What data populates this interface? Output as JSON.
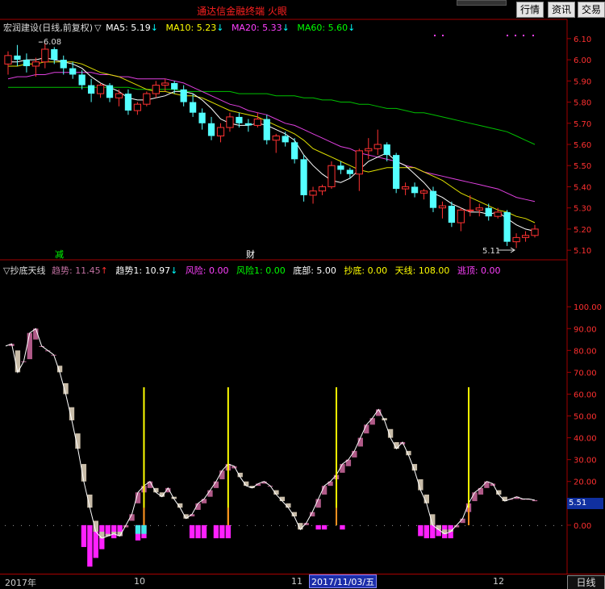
{
  "window": {
    "title": "通达信金融终端  火眼",
    "buttons": [
      "行情",
      "资讯",
      "交易"
    ]
  },
  "main_panel": {
    "legend": {
      "stock": "宏润建设(日线,前复权)",
      "marker": "▽",
      "ma": [
        {
          "label": "MA5: 5.19",
          "arrow": "↓",
          "color": "#ffffff"
        },
        {
          "label": "MA10: 5.23",
          "arrow": "↓",
          "color": "#ffff00"
        },
        {
          "label": "MA20: 5.33",
          "arrow": "↓",
          "color": "#ff40ff"
        },
        {
          "label": "MA60: 5.60",
          "arrow": "↓",
          "color": "#00ff00"
        }
      ]
    },
    "high_label": "6.08",
    "low_label": "5.11",
    "event_markers": [
      "减",
      "财"
    ]
  },
  "indicator_panel": {
    "legend": {
      "name": "抄底天线",
      "items": [
        {
          "label": "趋势: 11.45",
          "arrow": "↑",
          "color": "#c070a0"
        },
        {
          "label": "趋势1: 10.97",
          "arrow": "↓",
          "color": "#ffffff"
        },
        {
          "label": "风险: 0.00",
          "arrow": "",
          "color": "#ff40ff"
        },
        {
          "label": "风险1: 0.00",
          "arrow": "",
          "color": "#00ff00"
        },
        {
          "label": "底部: 5.00",
          "arrow": "",
          "color": "#ffffff"
        },
        {
          "label": "抄底: 0.00",
          "arrow": "",
          "color": "#ffff00"
        },
        {
          "label": "天线: 108.00",
          "arrow": "",
          "color": "#ffff00"
        },
        {
          "label": "逃顶: 0.00",
          "arrow": "",
          "color": "#ff40ff"
        }
      ]
    },
    "current_value": "5.51"
  },
  "timeline": {
    "labels": [
      "2017年",
      "10",
      "11",
      "12"
    ],
    "cursor": "2017/11/03/五",
    "period_button": "日线"
  },
  "chart_data": [
    {
      "type": "candlestick",
      "y_ticks": [
        "6.10",
        "6.00",
        "5.90",
        "5.80",
        "5.70",
        "5.60",
        "5.50",
        "5.40",
        "5.30",
        "5.20",
        "5.10"
      ],
      "ylim": [
        5.07,
        6.13
      ],
      "ohlc": [
        [
          5.98,
          6.04,
          5.93,
          6.02
        ],
        [
          6.02,
          6.07,
          5.97,
          6.0
        ],
        [
          6.0,
          6.03,
          5.94,
          5.97
        ],
        [
          5.97,
          6.01,
          5.92,
          5.99
        ],
        [
          5.99,
          6.08,
          5.96,
          6.05
        ],
        [
          6.05,
          6.06,
          5.98,
          6.0
        ],
        [
          6.0,
          6.02,
          5.93,
          5.96
        ],
        [
          5.96,
          5.99,
          5.91,
          5.93
        ],
        [
          5.93,
          5.95,
          5.86,
          5.88
        ],
        [
          5.88,
          5.91,
          5.8,
          5.84
        ],
        [
          5.84,
          5.89,
          5.82,
          5.88
        ],
        [
          5.88,
          5.89,
          5.8,
          5.82
        ],
        [
          5.82,
          5.86,
          5.78,
          5.84
        ],
        [
          5.84,
          5.86,
          5.74,
          5.76
        ],
        [
          5.76,
          5.8,
          5.74,
          5.79
        ],
        [
          5.79,
          5.85,
          5.78,
          5.84
        ],
        [
          5.84,
          5.9,
          5.82,
          5.88
        ],
        [
          5.88,
          5.91,
          5.85,
          5.89
        ],
        [
          5.89,
          5.9,
          5.84,
          5.86
        ],
        [
          5.86,
          5.88,
          5.78,
          5.8
        ],
        [
          5.8,
          5.84,
          5.73,
          5.75
        ],
        [
          5.75,
          5.77,
          5.67,
          5.7
        ],
        [
          5.7,
          5.73,
          5.62,
          5.64
        ],
        [
          5.64,
          5.7,
          5.61,
          5.68
        ],
        [
          5.68,
          5.75,
          5.66,
          5.73
        ],
        [
          5.73,
          5.75,
          5.68,
          5.7
        ],
        [
          5.7,
          5.72,
          5.66,
          5.69
        ],
        [
          5.69,
          5.75,
          5.68,
          5.72
        ],
        [
          5.72,
          5.74,
          5.6,
          5.62
        ],
        [
          5.62,
          5.65,
          5.56,
          5.64
        ],
        [
          5.64,
          5.66,
          5.59,
          5.61
        ],
        [
          5.61,
          5.63,
          5.51,
          5.53
        ],
        [
          5.53,
          5.55,
          5.33,
          5.36
        ],
        [
          5.36,
          5.4,
          5.32,
          5.38
        ],
        [
          5.38,
          5.41,
          5.36,
          5.4
        ],
        [
          5.4,
          5.52,
          5.39,
          5.5
        ],
        [
          5.5,
          5.52,
          5.46,
          5.48
        ],
        [
          5.48,
          5.49,
          5.44,
          5.46
        ],
        [
          5.46,
          5.58,
          5.38,
          5.57
        ],
        [
          5.57,
          5.63,
          5.53,
          5.58
        ],
        [
          5.58,
          5.67,
          5.55,
          5.6
        ],
        [
          5.6,
          5.61,
          5.52,
          5.55
        ],
        [
          5.55,
          5.56,
          5.37,
          5.39
        ],
        [
          5.39,
          5.42,
          5.36,
          5.4
        ],
        [
          5.4,
          5.42,
          5.35,
          5.37
        ],
        [
          5.37,
          5.39,
          5.34,
          5.38
        ],
        [
          5.38,
          5.4,
          5.28,
          5.3
        ],
        [
          5.3,
          5.33,
          5.25,
          5.31
        ],
        [
          5.31,
          5.33,
          5.21,
          5.23
        ],
        [
          5.23,
          5.3,
          5.19,
          5.29
        ],
        [
          5.29,
          5.36,
          5.26,
          5.29
        ],
        [
          5.29,
          5.32,
          5.26,
          5.3
        ],
        [
          5.3,
          5.32,
          5.24,
          5.26
        ],
        [
          5.26,
          5.3,
          5.25,
          5.28
        ],
        [
          5.28,
          5.29,
          5.12,
          5.14
        ],
        [
          5.14,
          5.18,
          5.11,
          5.16
        ],
        [
          5.16,
          5.19,
          5.14,
          5.17
        ],
        [
          5.17,
          5.22,
          5.16,
          5.2
        ]
      ],
      "ma5": [
        5.99,
        5.99,
        6.0,
        6.0,
        6.01,
        6.0,
        5.99,
        5.98,
        5.96,
        5.92,
        5.89,
        5.87,
        5.85,
        5.82,
        5.81,
        5.81,
        5.82,
        5.83,
        5.85,
        5.85,
        5.84,
        5.81,
        5.77,
        5.72,
        5.7,
        5.69,
        5.69,
        5.7,
        5.69,
        5.67,
        5.65,
        5.62,
        5.55,
        5.5,
        5.46,
        5.43,
        5.42,
        5.44,
        5.48,
        5.52,
        5.54,
        5.56,
        5.52,
        5.5,
        5.46,
        5.42,
        5.37,
        5.35,
        5.32,
        5.3,
        5.28,
        5.28,
        5.27,
        5.28,
        5.25,
        5.22,
        5.2,
        5.19
      ],
      "ma10": [
        5.97,
        5.97,
        5.98,
        5.98,
        5.99,
        5.99,
        5.99,
        5.99,
        5.98,
        5.96,
        5.94,
        5.93,
        5.92,
        5.9,
        5.88,
        5.86,
        5.85,
        5.85,
        5.84,
        5.83,
        5.83,
        5.82,
        5.8,
        5.78,
        5.76,
        5.75,
        5.74,
        5.73,
        5.71,
        5.69,
        5.67,
        5.65,
        5.62,
        5.58,
        5.56,
        5.54,
        5.52,
        5.5,
        5.48,
        5.47,
        5.48,
        5.49,
        5.49,
        5.49,
        5.49,
        5.47,
        5.45,
        5.43,
        5.4,
        5.37,
        5.35,
        5.33,
        5.31,
        5.29,
        5.28,
        5.26,
        5.25,
        5.23
      ],
      "ma20": [
        5.91,
        5.92,
        5.92,
        5.93,
        5.93,
        5.94,
        5.94,
        5.94,
        5.94,
        5.94,
        5.93,
        5.93,
        5.92,
        5.92,
        5.91,
        5.91,
        5.91,
        5.91,
        5.9,
        5.89,
        5.87,
        5.85,
        5.83,
        5.81,
        5.79,
        5.78,
        5.76,
        5.75,
        5.74,
        5.72,
        5.7,
        5.69,
        5.67,
        5.65,
        5.63,
        5.61,
        5.59,
        5.58,
        5.56,
        5.55,
        5.54,
        5.53,
        5.52,
        5.5,
        5.49,
        5.47,
        5.46,
        5.45,
        5.44,
        5.43,
        5.42,
        5.41,
        5.4,
        5.39,
        5.37,
        5.35,
        5.34,
        5.33
      ],
      "ma60": [
        5.87,
        5.87,
        5.87,
        5.87,
        5.87,
        5.87,
        5.87,
        5.87,
        5.87,
        5.87,
        5.87,
        5.87,
        5.87,
        5.87,
        5.86,
        5.86,
        5.86,
        5.86,
        5.86,
        5.85,
        5.85,
        5.85,
        5.85,
        5.85,
        5.85,
        5.84,
        5.84,
        5.84,
        5.84,
        5.83,
        5.83,
        5.83,
        5.82,
        5.82,
        5.81,
        5.81,
        5.8,
        5.8,
        5.79,
        5.79,
        5.78,
        5.77,
        5.77,
        5.76,
        5.75,
        5.75,
        5.74,
        5.73,
        5.72,
        5.71,
        5.7,
        5.69,
        5.68,
        5.67,
        5.66,
        5.64,
        5.62,
        5.6
      ]
    },
    {
      "type": "bar",
      "y_ticks": [
        "100.00",
        "90.00",
        "80.00",
        "70.00",
        "60.00",
        "50.00",
        "40.00",
        "30.00",
        "20.00",
        "10.00",
        "0.00"
      ],
      "ylim": [
        -20,
        113
      ],
      "trend": [
        82,
        83,
        70,
        75,
        88,
        90,
        82,
        80,
        78,
        70,
        60,
        48,
        35,
        20,
        8,
        -3,
        -6,
        -5,
        -4,
        -5,
        0,
        5,
        15,
        18,
        20,
        15,
        13,
        17,
        12,
        8,
        3,
        5,
        10,
        12,
        16,
        20,
        25,
        28,
        27,
        22,
        18,
        17,
        19,
        20,
        18,
        14,
        11,
        8,
        4,
        -2,
        1,
        6,
        12,
        18,
        20,
        23,
        28,
        30,
        34,
        40,
        46,
        49,
        53,
        48,
        40,
        35,
        38,
        32,
        25,
        16,
        10,
        0,
        -2,
        -4,
        -3,
        0,
        3,
        10,
        15,
        17,
        20,
        19,
        14,
        11,
        12,
        13,
        12,
        12,
        11.45
      ],
      "trend1": [
        0,
        82,
        80,
        75,
        76,
        85,
        82,
        80,
        78,
        73,
        65,
        54,
        42,
        28,
        14,
        2,
        -3,
        -4,
        -3,
        -3,
        -1,
        2,
        10,
        15,
        17,
        17,
        15,
        15,
        13,
        10,
        5,
        4,
        7,
        10,
        13,
        17,
        21,
        25,
        26,
        24,
        20,
        18,
        18,
        19,
        18,
        16,
        13,
        10,
        6,
        1,
        0,
        4,
        8,
        14,
        18,
        21,
        24,
        27,
        31,
        36,
        42,
        46,
        50,
        49,
        44,
        38,
        37,
        34,
        28,
        21,
        14,
        5,
        0,
        -2,
        -2,
        -1,
        1,
        6,
        11,
        14,
        17,
        18,
        16,
        13,
        12,
        12,
        12,
        12,
        10.97
      ],
      "risk_bars": [
        [
          13,
          10
        ],
        [
          14,
          19
        ],
        [
          15,
          15
        ],
        [
          16,
          11
        ],
        [
          17,
          5
        ],
        [
          18,
          6
        ],
        [
          19,
          5
        ],
        [
          22,
          7
        ],
        [
          23,
          6
        ],
        [
          31,
          6
        ],
        [
          32,
          6
        ],
        [
          33,
          6
        ],
        [
          35,
          6
        ],
        [
          36,
          6
        ],
        [
          37,
          6
        ],
        [
          52,
          2
        ],
        [
          53,
          2
        ],
        [
          56,
          2
        ],
        [
          69,
          5
        ],
        [
          70,
          6
        ],
        [
          71,
          6
        ],
        [
          72,
          5
        ],
        [
          73,
          6
        ],
        [
          74,
          6
        ]
      ],
      "risk1_bars": [
        [
          22,
          4
        ],
        [
          23,
          4
        ]
      ],
      "antenna_index": [
        23,
        37,
        55,
        77
      ],
      "antenna_value": 108.0
    }
  ]
}
